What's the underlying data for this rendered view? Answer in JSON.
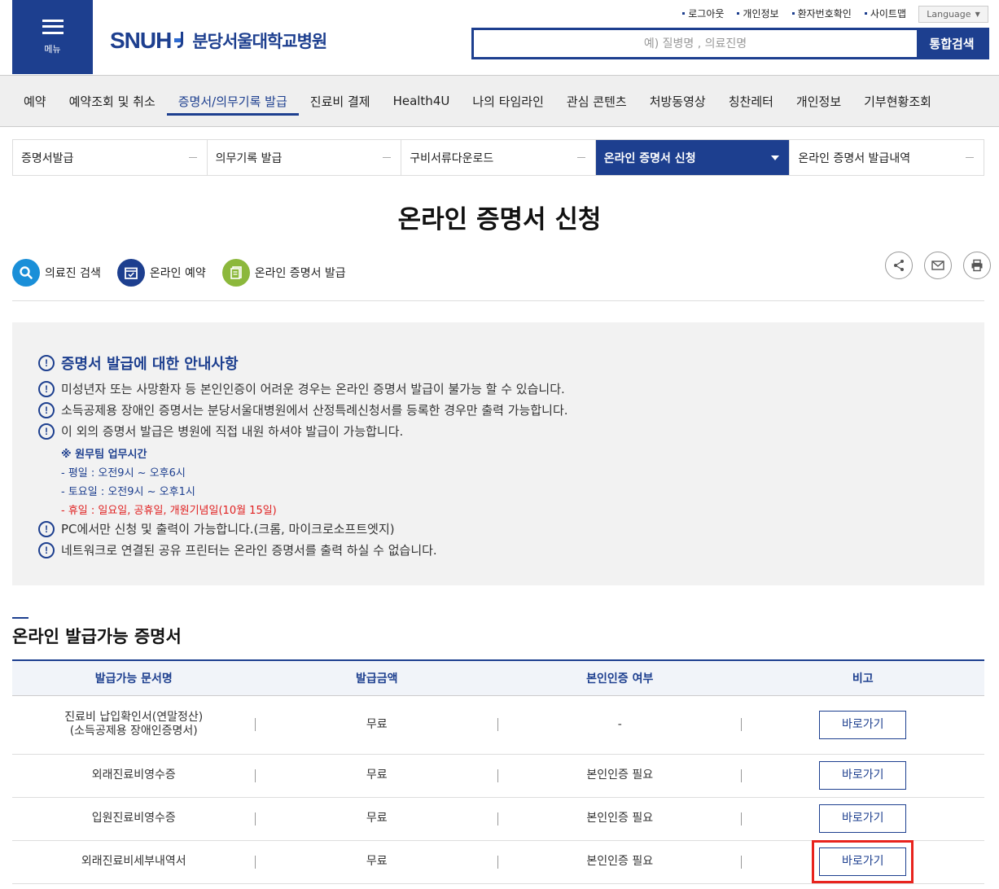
{
  "header": {
    "menu_label": "메뉴",
    "logo_en": "SNUH",
    "logo_ko": "분당서울대학교병원",
    "util_links": [
      "로그아웃",
      "개인정보",
      "환자번호확인",
      "사이트맵"
    ],
    "language_label": "Language",
    "search_placeholder": "예) 질병명 , 의료진명",
    "search_button": "통합검색"
  },
  "gnb": {
    "items": [
      "예약",
      "예약조회 및 취소",
      "증명서/의무기록 발급",
      "진료비 결제",
      "Health4U",
      "나의 타임라인",
      "관심 콘텐츠",
      "처방동영상",
      "칭찬레터",
      "개인정보",
      "기부현황조회"
    ],
    "active_index": 2
  },
  "subtabs": {
    "items": [
      "증명서발급",
      "의무기록 발급",
      "구비서류다운로드",
      "온라인 증명서 신청",
      "온라인 증명서 발급내역"
    ],
    "active_index": 3
  },
  "page_title": "온라인 증명서 신청",
  "quick_links": [
    "의료진 검색",
    "온라인 예약",
    "온라인 증명서 발급"
  ],
  "colors": {
    "primary": "#1d3f8f",
    "search_blue": "#1a8fd8",
    "green": "#8cb83c",
    "red": "#e02020"
  },
  "notice": {
    "title": "증명서 발급에 대한 안내사항",
    "items": [
      "미성년자 또는 사망환자 등 본인인증이 어려운 경우는 온라인 증명서 발급이 불가능 할 수 있습니다.",
      "소득공제용 장애인 증명서는 분당서울대병원에서 산정특례신청서를 등록한 경우만 출력 가능합니다.",
      "이 외의 증명서 발급은 병원에 직접 내원 하셔야 발급이 가능합니다."
    ],
    "hours_title": "※ 원무팀 업무시간",
    "hours": [
      "- 평일 : 오전9시 ~ 오후6시",
      "- 토요일 : 오전9시 ~ 오후1시",
      "- 휴일 : 일요일, 공휴일, 개원기념일(10월 15일)"
    ],
    "items2": [
      "PC에서만 신청 및 출력이 가능합니다.(크롬, 마이크로소프트엣지)",
      "네트워크로 연결된 공유 프린터는 온라인 증명서를 출력 하실 수 없습니다."
    ]
  },
  "section_title": "온라인 발급가능 증명서",
  "table": {
    "headers": [
      "발급가능 문서명",
      "발급금액",
      "본인인증 여부",
      "비고"
    ],
    "rows": [
      {
        "name1": "진료비 납입확인서(연말정산)",
        "name2": "(소득공제용 장애인증명서)",
        "fee": "무료",
        "auth": "-",
        "action": "바로가기"
      },
      {
        "name1": "외래진료비영수증",
        "fee": "무료",
        "auth": "본인인증 필요",
        "action": "바로가기"
      },
      {
        "name1": "입원진료비영수증",
        "fee": "무료",
        "auth": "본인인증 필요",
        "action": "바로가기"
      },
      {
        "name1": "외래진료비세부내역서",
        "fee": "무료",
        "auth": "본인인증 필요",
        "action": "바로가기"
      }
    ]
  }
}
